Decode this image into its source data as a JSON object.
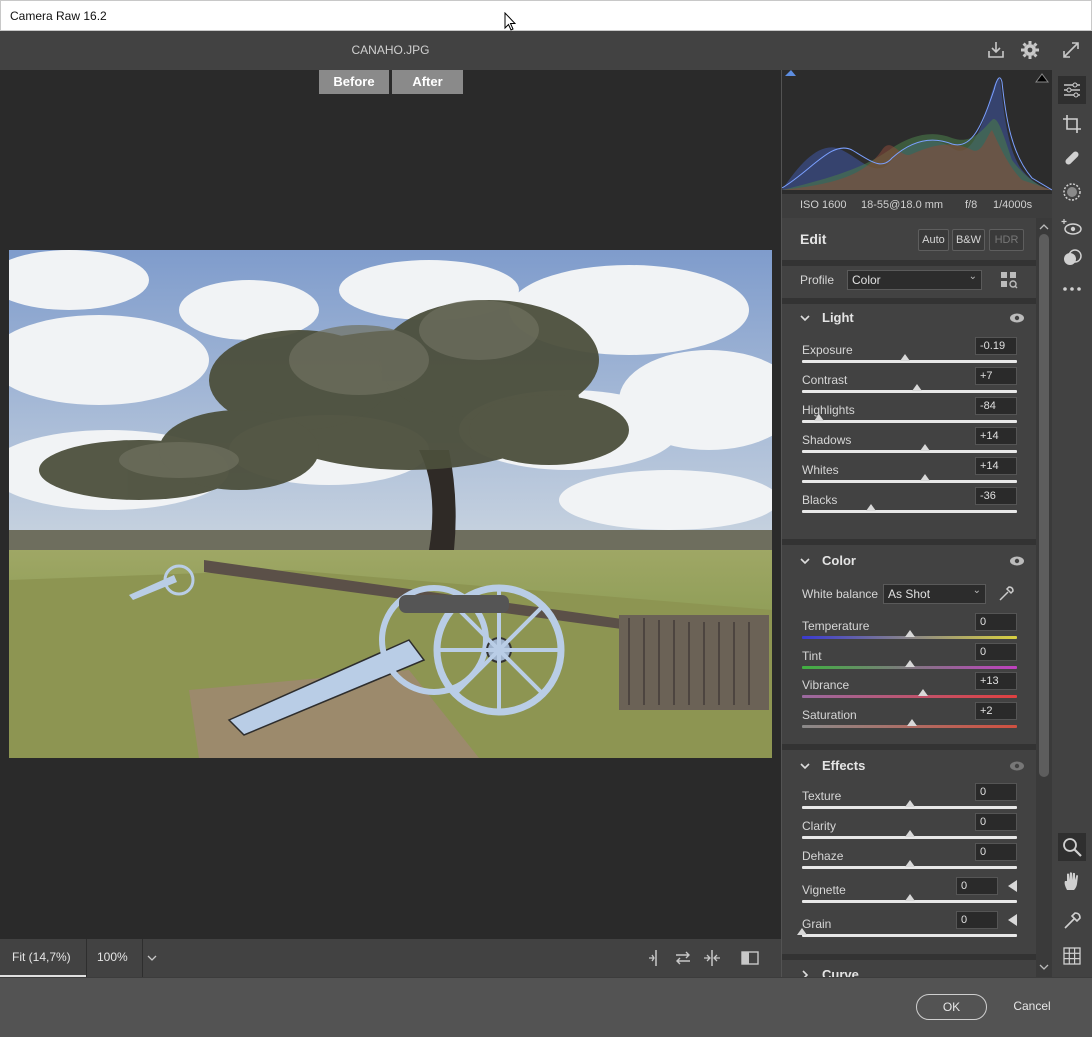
{
  "window": {
    "title": "Camera Raw 16.2"
  },
  "header": {
    "filename": "CANAHO.JPG"
  },
  "viewer": {
    "before_label": "Before",
    "after_label": "After"
  },
  "bottom_toolbar": {
    "zoom_fit": "Fit (14,7%)",
    "zoom_percent": "100%"
  },
  "footer": {
    "ok_label": "OK",
    "cancel_label": "Cancel"
  },
  "metadata": {
    "iso": "ISO 1600",
    "lens": "18-55@18.0 mm",
    "aperture": "f/8",
    "shutter": "1/4000s"
  },
  "edit": {
    "title": "Edit",
    "auto_label": "Auto",
    "bw_label": "B&W",
    "hdr_label": "HDR"
  },
  "profile": {
    "label": "Profile",
    "value": "Color"
  },
  "light": {
    "title": "Light",
    "sliders": [
      {
        "label": "Exposure",
        "value": "-0.19",
        "fraction": 0.48
      },
      {
        "label": "Contrast",
        "value": "+7",
        "fraction": 0.535
      },
      {
        "label": "Highlights",
        "value": "-84",
        "fraction": 0.08
      },
      {
        "label": "Shadows",
        "value": "+14",
        "fraction": 0.57
      },
      {
        "label": "Whites",
        "value": "+14",
        "fraction": 0.57
      },
      {
        "label": "Blacks",
        "value": "-36",
        "fraction": 0.32
      }
    ]
  },
  "color": {
    "title": "Color",
    "wb_label": "White balance",
    "wb_value": "As Shot",
    "sliders": [
      {
        "label": "Temperature",
        "value": "0",
        "fraction": 0.5
      },
      {
        "label": "Tint",
        "value": "0",
        "fraction": 0.5
      },
      {
        "label": "Vibrance",
        "value": "+13",
        "fraction": 0.565
      },
      {
        "label": "Saturation",
        "value": "+2",
        "fraction": 0.51
      }
    ]
  },
  "effects": {
    "title": "Effects",
    "sliders": [
      {
        "label": "Texture",
        "value": "0",
        "fraction": 0.5
      },
      {
        "label": "Clarity",
        "value": "0",
        "fraction": 0.5
      },
      {
        "label": "Dehaze",
        "value": "0",
        "fraction": 0.5
      },
      {
        "label": "Vignette",
        "value": "0",
        "fraction": 0.5
      },
      {
        "label": "Grain",
        "value": "0",
        "fraction": 0.0
      }
    ]
  },
  "curve": {
    "title": "Curve"
  },
  "colors": {
    "panel": "#424242",
    "viewer": "#2a2a2a",
    "temperature_gradient": [
      "#3a3ad0",
      "#d8d040"
    ],
    "tint_gradient": [
      "#40b040",
      "#c040c0"
    ],
    "vibrance_gradient": [
      "#9a6aa0",
      "#e04040"
    ]
  },
  "icons": [
    "export-icon",
    "gear-icon",
    "fullscreen-icon",
    "edit-sliders-icon",
    "crop-icon",
    "healing-icon",
    "masking-icon",
    "red-eye-icon",
    "presets-icon",
    "more-icon",
    "zoom-icon",
    "hand-icon",
    "color-sampler-icon",
    "grid-icon"
  ]
}
